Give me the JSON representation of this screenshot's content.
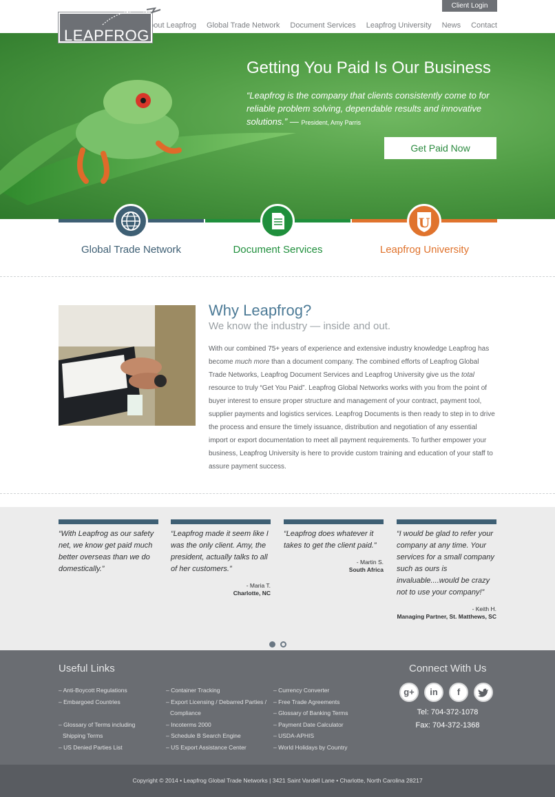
{
  "header": {
    "client_login": "Client Login",
    "logo_text": "LEAPFROG",
    "nav": [
      "About Leapfrog",
      "Global Trade Network",
      "Document Services",
      "Leapfrog University",
      "News",
      "Contact"
    ]
  },
  "hero": {
    "title": "Getting You Paid Is Our Business",
    "quote": "“Leapfrog is the company that clients consistently come to for reliable problem solving, dependable results and innovative solutions.” —",
    "attribution": "President, Amy Parris",
    "cta": "Get Paid Now"
  },
  "services": [
    {
      "label": "Global Trade Network",
      "color": "#3e5f74",
      "icon": "globe-icon"
    },
    {
      "label": "Document Services",
      "color": "#1f8f3c",
      "icon": "document-icon"
    },
    {
      "label": "Leapfrog University",
      "color": "#e0732d",
      "icon": "university-shield-icon"
    }
  ],
  "why": {
    "title": "Why Leapfrog?",
    "subtitle": "We know the industry — inside and out.",
    "body_1": "With our combined 75+ years of experience and extensive industry knowledge Leapfrog has become ",
    "body_em1": "much more",
    "body_2": " than a document company.  The combined efforts of Leapfrog Global Trade Networks, Leapfrog Document Services and Leapfrog University give us the ",
    "body_em2": "total",
    "body_3": " resource to truly “Get You Paid”.  Leapfrog Global Networks works with you from the point of buyer interest to ensure proper structure and management of your contract, payment tool, supplier payments and logistics services.   Leapfrog Documents is then ready to step in to drive the process and ensure the timely issuance, distribution and negotiation of any essential import or export documentation to meet all payment requirements. To further empower your business, Leapfrog University is here to provide custom training and education of your staff to assure payment success."
  },
  "testimonials": [
    {
      "quote": "“With Leapfrog as our safety net, we know get paid much better overseas than we do domestically.”",
      "name": "",
      "location": ""
    },
    {
      "quote": "“Leapfrog made it seem like I was the only client.  Amy, the president, actually talks to all of her customers.”",
      "name": "- Maria T.",
      "location": "Charlotte, NC"
    },
    {
      "quote": "“Leapfrog does whatever it takes to get the client paid.”",
      "name": "- Martin S.",
      "location": "South Africa"
    },
    {
      "quote": "“I would be glad to refer your company at any time.  Your services for a small company such as ours is invaluable....would be crazy not to use your company!”",
      "name": "- Keith H.",
      "location": "Managing Partner, St. Matthews, SC"
    }
  ],
  "footer": {
    "useful_title": "Useful Links",
    "col1": [
      "– Anti-Boycott Regulations",
      "– Embargoed Countries",
      "",
      "– Glossary of Terms including Shipping Terms",
      "– US Denied Parties List"
    ],
    "col2": [
      "– Container Tracking",
      "– Export Licensing / Debarred Parties / Compliance",
      "– Incoterms 2000",
      "– Schedule B Search Engine",
      "– US Export Assistance Center"
    ],
    "col3": [
      "– Currency Converter",
      "– Free Trade Agreements",
      "– Glossary of Banking Terms",
      "– Payment Date Calculator",
      "– USDA-APHIS",
      "– World Holidays by Country"
    ],
    "connect_title": "Connect With Us",
    "social": [
      "google-plus-icon",
      "linkedin-icon",
      "facebook-icon",
      "twitter-icon"
    ],
    "tel_label": "Tel:",
    "tel": "704-372-1078",
    "fax_label": "Fax:",
    "fax": "704-372-1368",
    "copyright": "Copyright © 2014 • Leapfrog Global Trade Networks | 3421 Saint Vardell Lane • Charlotte, North Carolina 28217"
  }
}
